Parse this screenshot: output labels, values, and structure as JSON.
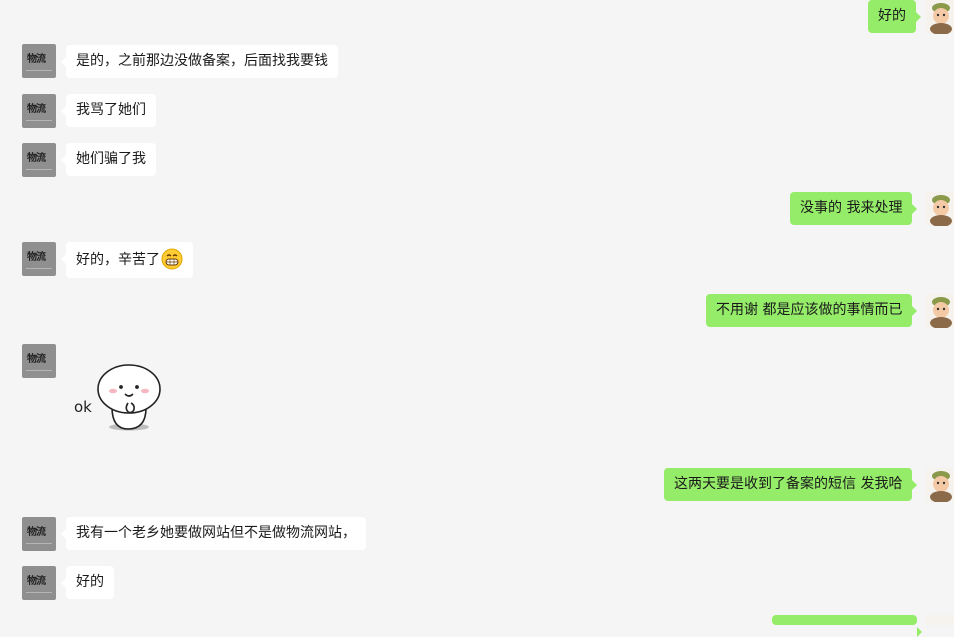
{
  "contact_avatar_text": "物流",
  "messages": [
    {
      "side": "out",
      "text": "好的"
    },
    {
      "side": "in",
      "text": "是的，之前那边没做备案，后面找我要钱"
    },
    {
      "side": "in",
      "text": "我骂了她们"
    },
    {
      "side": "in",
      "text": "她们骗了我"
    },
    {
      "side": "out",
      "text": "没事的 我来处理"
    },
    {
      "side": "in",
      "text": "好的，辛苦了",
      "emoji": "grin-emoji"
    },
    {
      "side": "out",
      "text": "不用谢 都是应该做的事情而已"
    },
    {
      "side": "in",
      "sticker": "ok-sticker",
      "sticker_text": "ok"
    },
    {
      "side": "out",
      "text": "这两天要是收到了备案的短信 发我哈"
    },
    {
      "side": "in",
      "text": "我有一个老乡她要做网站但不是做物流网站，"
    },
    {
      "side": "in",
      "text": "好的"
    }
  ],
  "colors": {
    "background": "#f5f5f5",
    "incoming_bubble": "#ffffff",
    "outgoing_bubble": "#95ec69"
  }
}
